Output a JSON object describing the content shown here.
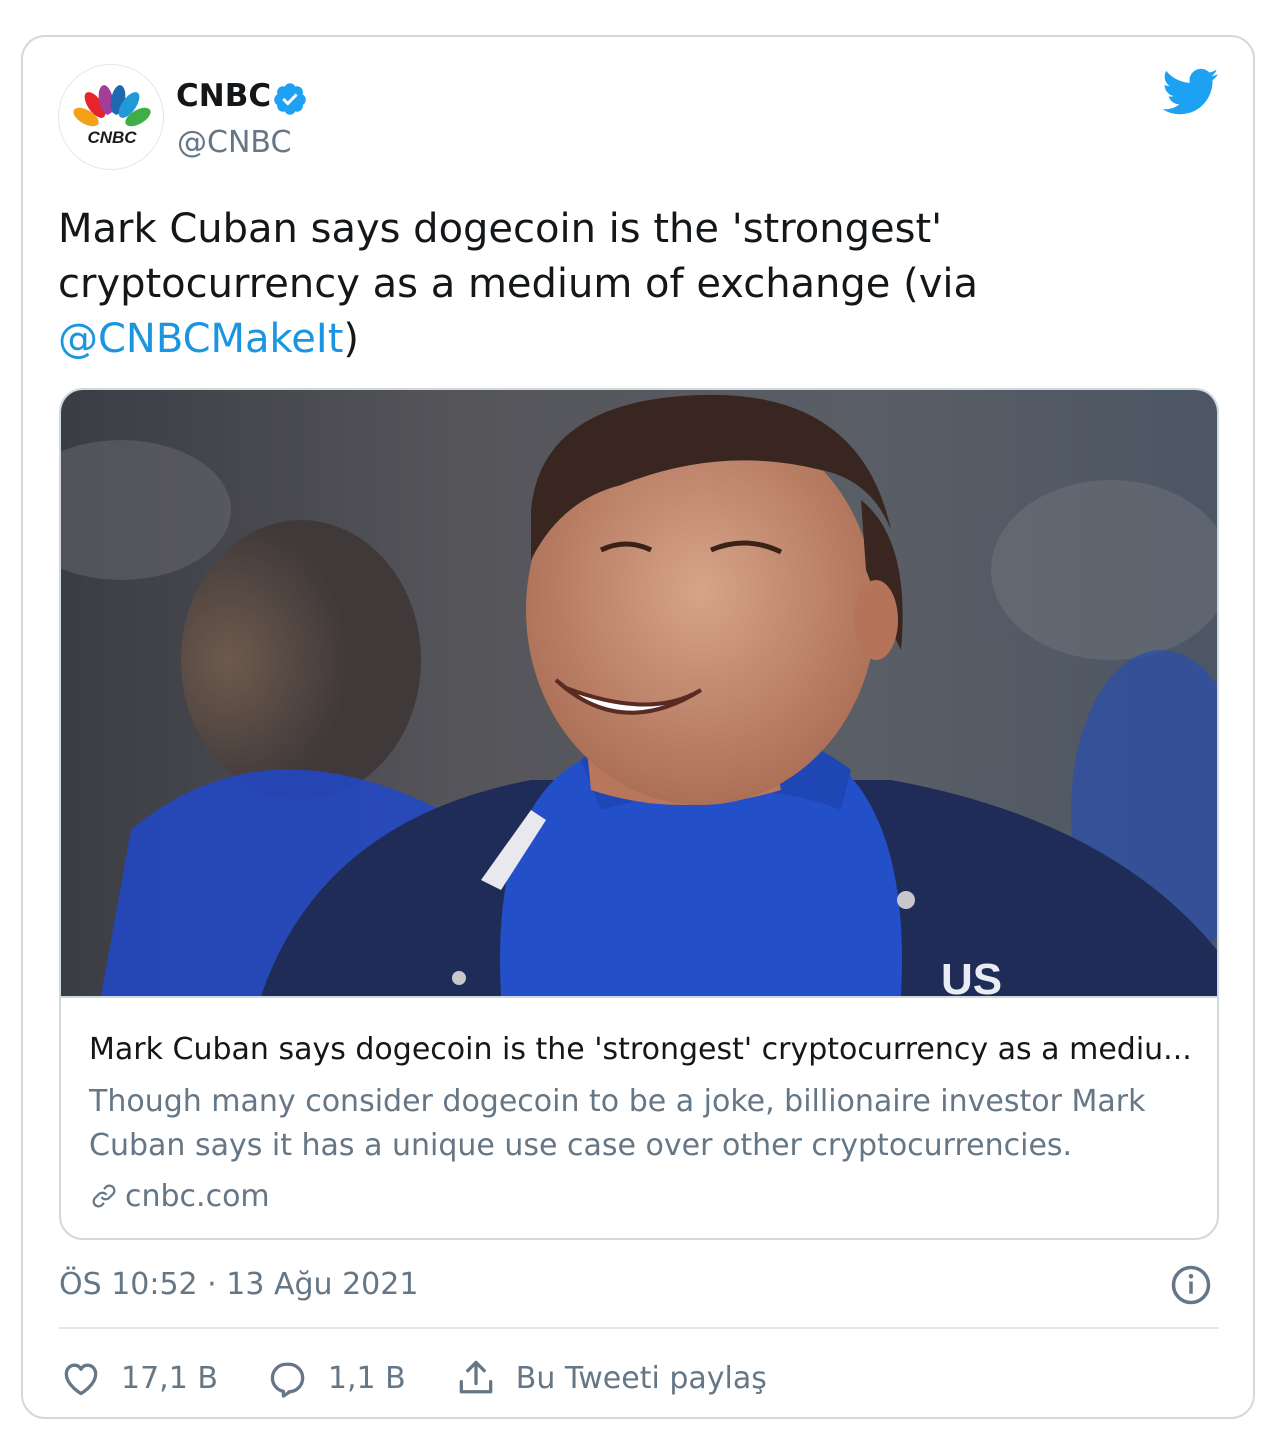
{
  "author": {
    "display_name": "CNBC",
    "handle": "@CNBC",
    "avatar_text": "CNBC",
    "verified": true
  },
  "tweet": {
    "text_prefix": "Mark Cuban says dogecoin is the 'strongest' cryptocurrency as a medium of exchange (via ",
    "mention": "@CNBCMakeIt",
    "text_suffix": ")"
  },
  "link_card": {
    "image_icon": "mark-cuban-photo",
    "image_text": "US",
    "title": "Mark Cuban says dogecoin is the 'strongest' cryptocurrency as a mediu...",
    "description": "Though many consider dogecoin to be a joke, billionaire investor Mark Cuban says it has a unique use case over other cryptocurrencies.",
    "domain": "cnbc.com"
  },
  "timestamp": "ÖS 10:52 · 13 Ağu 2021",
  "actions": {
    "like_count": "17,1 B",
    "reply_count": "1,1 B",
    "share_label": "Bu Tweeti paylaş"
  },
  "colors": {
    "link": "#1b95e0",
    "twitter_blue": "#1da1f2",
    "secondary_text": "#657786",
    "border": "#cfd9de"
  }
}
